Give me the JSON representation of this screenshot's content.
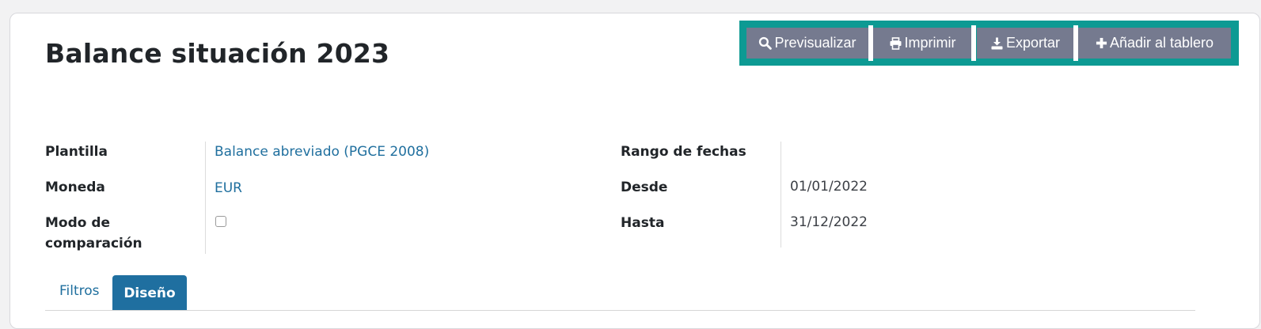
{
  "page": {
    "title": "Balance situación 2023"
  },
  "toolbar": {
    "preview_label": "Previsualizar",
    "print_label": "Imprimir",
    "export_label": "Exportar",
    "add_dashboard_label": "Añadir al tablero",
    "accent_color": "#0d9a93",
    "button_color": "#757a8f"
  },
  "form": {
    "plantilla_label": "Plantilla",
    "plantilla_value": "Balance abreviado (PGCE 2008)",
    "moneda_label": "Moneda",
    "moneda_value": "EUR",
    "comparacion_label_line1": "Modo de",
    "comparacion_label_line2": "comparación",
    "comparacion_checked": false,
    "rango_label": "Rango de fechas",
    "desde_label": "Desde",
    "desde_value": "01/01/2022",
    "hasta_label": "Hasta",
    "hasta_value": "31/12/2022"
  },
  "tabs": [
    {
      "label": "Filtros",
      "active": false
    },
    {
      "label": "Diseño",
      "active": true
    }
  ]
}
